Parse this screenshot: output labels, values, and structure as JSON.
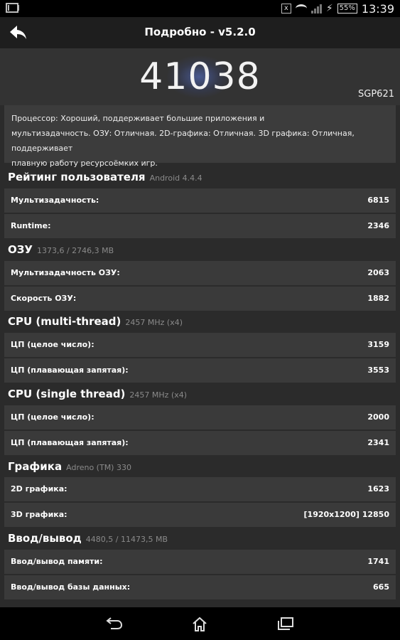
{
  "status": {
    "battery": "55%",
    "time": "13:39"
  },
  "header": {
    "title": "Подробно - v5.2.0"
  },
  "summary": {
    "score": "41038",
    "device": "SGP621"
  },
  "description": "Процессор: Хороший, поддерживает большие приложения и мультизадачность. ОЗУ: Отличная. 2D-графика: Отличная. 3D графика: Отличная, поддерживает плавную работу ресурсоёмких игр.",
  "description_lines": [
    "Процессор: Хороший, поддерживает большие приложения и",
    "мультизадачность. ОЗУ: Отличная. 2D-графика: Отличная. 3D графика: Отличная, поддерживает",
    "плавную работу ресурсоёмких игр."
  ],
  "sections": [
    {
      "title": "Рейтинг пользователя",
      "subtitle": "Android 4.4.4",
      "rows": [
        {
          "label": "Мультизадачность:",
          "value": "6815"
        },
        {
          "label": "Runtime:",
          "value": "2346"
        }
      ]
    },
    {
      "title": "ОЗУ",
      "subtitle": "1373,6 / 2746,3 MB",
      "rows": [
        {
          "label": "Мультизадачность ОЗУ:",
          "value": "2063"
        },
        {
          "label": "Скорость ОЗУ:",
          "value": "1882"
        }
      ]
    },
    {
      "title": "CPU (multi-thread)",
      "subtitle": "2457 MHz (x4)",
      "rows": [
        {
          "label": "ЦП (целое число):",
          "value": "3159"
        },
        {
          "label": "ЦП (плавающая запятая):",
          "value": "3553"
        }
      ]
    },
    {
      "title": "CPU (single thread)",
      "subtitle": "2457 MHz (x4)",
      "rows": [
        {
          "label": "ЦП (целое число):",
          "value": "2000"
        },
        {
          "label": "ЦП (плавающая запятая):",
          "value": "2341"
        }
      ]
    },
    {
      "title": "Графика",
      "subtitle": "Adreno (TM) 330",
      "rows": [
        {
          "label": "2D графика:",
          "value": "1623"
        },
        {
          "label": "3D графика:",
          "value": "[1920x1200] 12850"
        }
      ]
    },
    {
      "title": "Ввод/вывод",
      "subtitle": "4480,5 / 11473,5 MB",
      "rows": [
        {
          "label": "Ввод/вывод памяти:",
          "value": "1741"
        },
        {
          "label": "Ввод/вывод базы данных:",
          "value": "665"
        }
      ]
    }
  ],
  "icons": {
    "back": "arrow-back-icon",
    "gmail": "gmail-icon",
    "wifi": "wifi-icon",
    "signal": "signal-icon",
    "charging": "bolt-icon",
    "nav_back": "nav-back-icon",
    "nav_home": "nav-home-icon",
    "nav_recents": "nav-recents-icon"
  },
  "colors": {
    "background": "#2b2b2b",
    "card": "#3a3a3a",
    "actionbar": "#1e1e1e"
  }
}
